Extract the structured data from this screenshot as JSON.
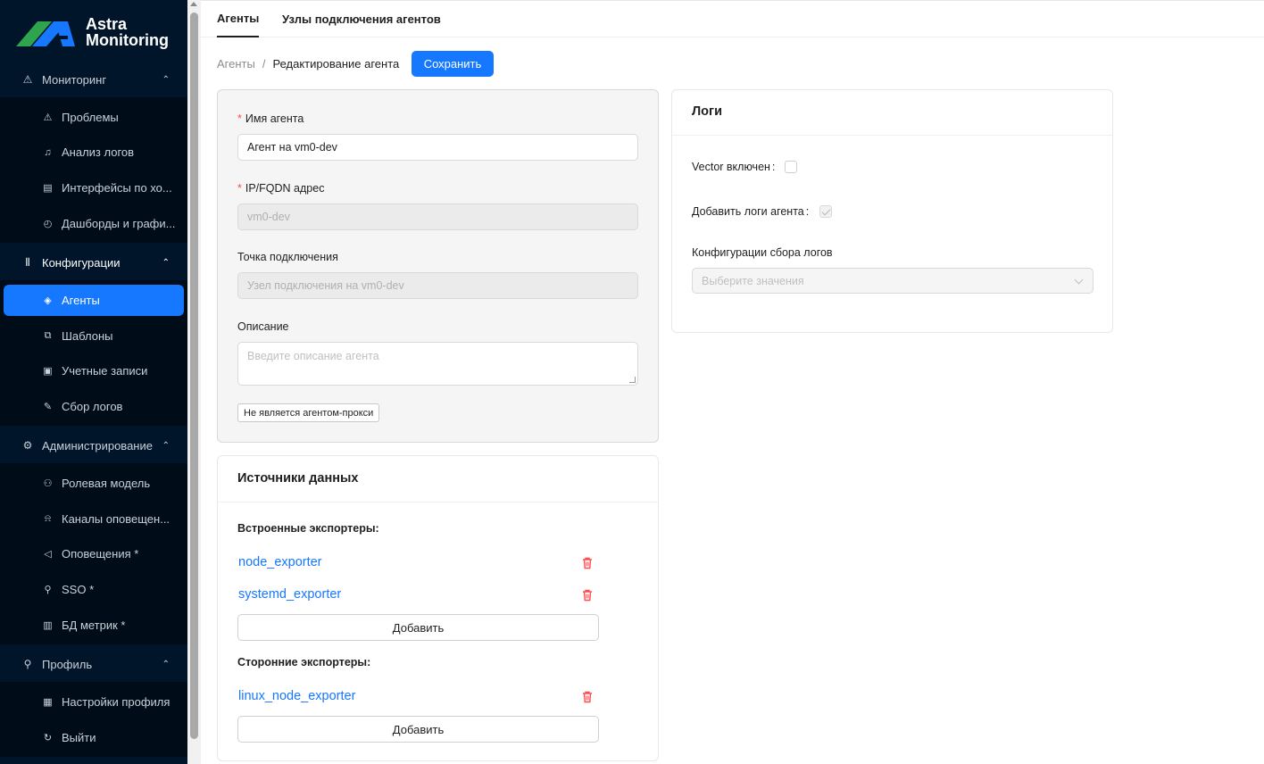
{
  "app": {
    "logo_line1": "Astra",
    "logo_line2": "Monitoring",
    "brand_colors": {
      "green": "#2ea44f",
      "blue": "#1677ff",
      "sidebar": "#001529"
    }
  },
  "sidebar": {
    "groups": [
      {
        "label": "Мониторинг",
        "icon": "warning-icon",
        "items": [
          {
            "label": "Проблемы",
            "icon": "warning-icon"
          },
          {
            "label": "Анализ логов",
            "icon": "bell-icon"
          },
          {
            "label": "Интерфейсы по хо...",
            "icon": "table-icon"
          },
          {
            "label": "Дашборды и графи...",
            "icon": "dashboard-icon"
          }
        ]
      },
      {
        "label": "Конфигурации",
        "icon": "sliders-icon",
        "items": [
          {
            "label": "Агенты",
            "icon": "tag-icon"
          },
          {
            "label": "Шаблоны",
            "icon": "copy-icon"
          },
          {
            "label": "Учетные записи",
            "icon": "id-card-icon"
          },
          {
            "label": "Сбор логов",
            "icon": "file-edit-icon"
          }
        ]
      },
      {
        "label": "Администрирование",
        "icon": "gear-icon",
        "items": [
          {
            "label": "Ролевая модель",
            "icon": "users-icon"
          },
          {
            "label": "Каналы оповещен...",
            "icon": "alert-icon"
          },
          {
            "label": "Оповещения *",
            "icon": "megaphone-icon"
          },
          {
            "label": "SSO *",
            "icon": "key-icon"
          },
          {
            "label": "БД метрик *",
            "icon": "database-icon"
          }
        ]
      },
      {
        "label": "Профиль",
        "icon": "user-icon",
        "items": [
          {
            "label": "Настройки профиля",
            "icon": "profile-card-icon"
          },
          {
            "label": "Выйти",
            "icon": "logout-icon"
          }
        ]
      }
    ]
  },
  "tabs": [
    {
      "label": "Агенты",
      "active": true
    },
    {
      "label": "Узлы подключения агентов",
      "active": false
    }
  ],
  "breadcrumb": {
    "root": "Агенты",
    "separator": "/",
    "current": "Редактирование агента"
  },
  "save_button": "Сохранить",
  "agent_form": {
    "name_label": "Имя агента",
    "name_value": "Агент на vm0-dev",
    "address_label": "IP/FQDN адрес",
    "address_value": "vm0-dev",
    "endpoint_label": "Точка подключения",
    "endpoint_value": "Узел подключения на vm0-dev",
    "description_label": "Описание",
    "description_placeholder": "Введите описание агента",
    "proxy_tag": "Не является агентом-прокси",
    "required_mark": "*"
  },
  "data_sources": {
    "title": "Источники данных",
    "builtin_title": "Встроенные экспортеры:",
    "builtin": [
      "node_exporter",
      "systemd_exporter"
    ],
    "thirdparty_title": "Сторонние экспортеры:",
    "thirdparty": [
      "linux_node_exporter"
    ],
    "add_label": "Добавить"
  },
  "logs": {
    "title": "Логи",
    "vector_label": "Vector включен",
    "vector_checked": false,
    "agent_logs_label": "Добавить логи агента",
    "agent_logs_checked": true,
    "colon": ":",
    "config_label": "Конфигурации сбора логов",
    "config_placeholder": "Выберите значения"
  }
}
